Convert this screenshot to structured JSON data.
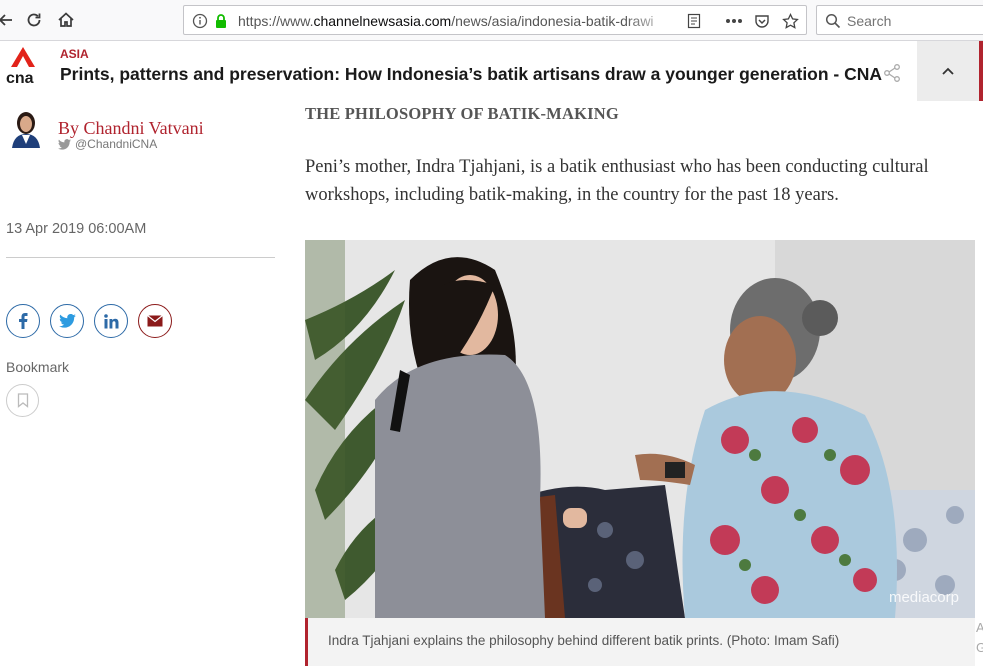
{
  "browser": {
    "url_prefix": "https://www.",
    "url_host": "channelnewsasia.com",
    "url_path": "/news/asia/indonesia-batik-drawi",
    "search_placeholder": "Search",
    "icons": [
      "back-icon",
      "reload-icon",
      "home-icon",
      "info-icon",
      "lock-icon",
      "reader-view-icon",
      "more-icon",
      "pocket-icon",
      "bookmark-star-icon",
      "search-icon"
    ]
  },
  "site": {
    "section": "ASIA",
    "headline": "Prints, patterns and preservation: How Indonesia’s batik artisans draw a younger generation - CNA",
    "brand_color": "#b0232e"
  },
  "author": {
    "byline": "By Chandni Vatvani",
    "twitter": "@ChandniCNA",
    "date": "13 Apr 2019 06:00AM"
  },
  "share": {
    "icons": [
      "facebook-icon",
      "twitter-icon",
      "linkedin-icon",
      "email-icon"
    ],
    "bookmark_label": "Bookmark"
  },
  "article": {
    "subhead": "THE PHILOSOPHY OF BATIK-MAKING",
    "paragraph": "Peni’s mother, Indra Tjahjani, is a batik enthusiast who has been conducting cultural workshops, including batik-making, in the country for the past 18 years.",
    "photo_watermark": "mediacorp",
    "caption": "Indra Tjahjani explains the philosophy behind different batik prints. (Photo: Imam Safi)",
    "edge_letters": [
      "A",
      "G"
    ]
  }
}
